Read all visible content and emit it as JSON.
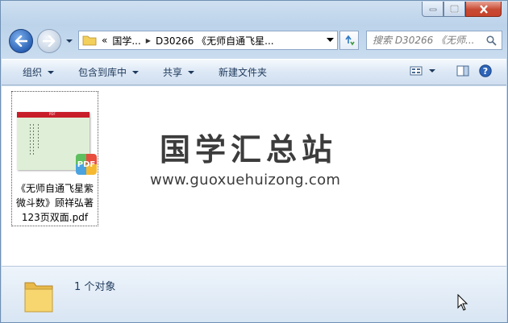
{
  "window": {
    "caption": {
      "minimize_icon": "minimize-icon",
      "maximize_icon": "maximize-icon",
      "close_icon": "close-icon"
    }
  },
  "nav": {
    "address": {
      "overflow": "«",
      "crumb_1": "国学...",
      "crumb_2": "D30266 《无师自通飞星..."
    },
    "search": {
      "placeholder": "搜索 D30266 《无师..."
    }
  },
  "toolbar": {
    "organize": "组织",
    "include_in_library": "包含到库中",
    "share": "共享",
    "new_folder": "新建文件夹"
  },
  "files": [
    {
      "name": "《无师自通飞星紫微斗数》顾祥弘著123页双面.pdf",
      "badge": "PDF",
      "thumb_label": "PDF"
    }
  ],
  "watermark": {
    "title": "国学汇总站",
    "url": "www.guoxuehuizong.com"
  },
  "details": {
    "count_text": "1 个对象"
  },
  "colors": {
    "accent": "#1e395b",
    "thumb_header": "#c81e2a",
    "thumb_body": "#dfefd7"
  }
}
